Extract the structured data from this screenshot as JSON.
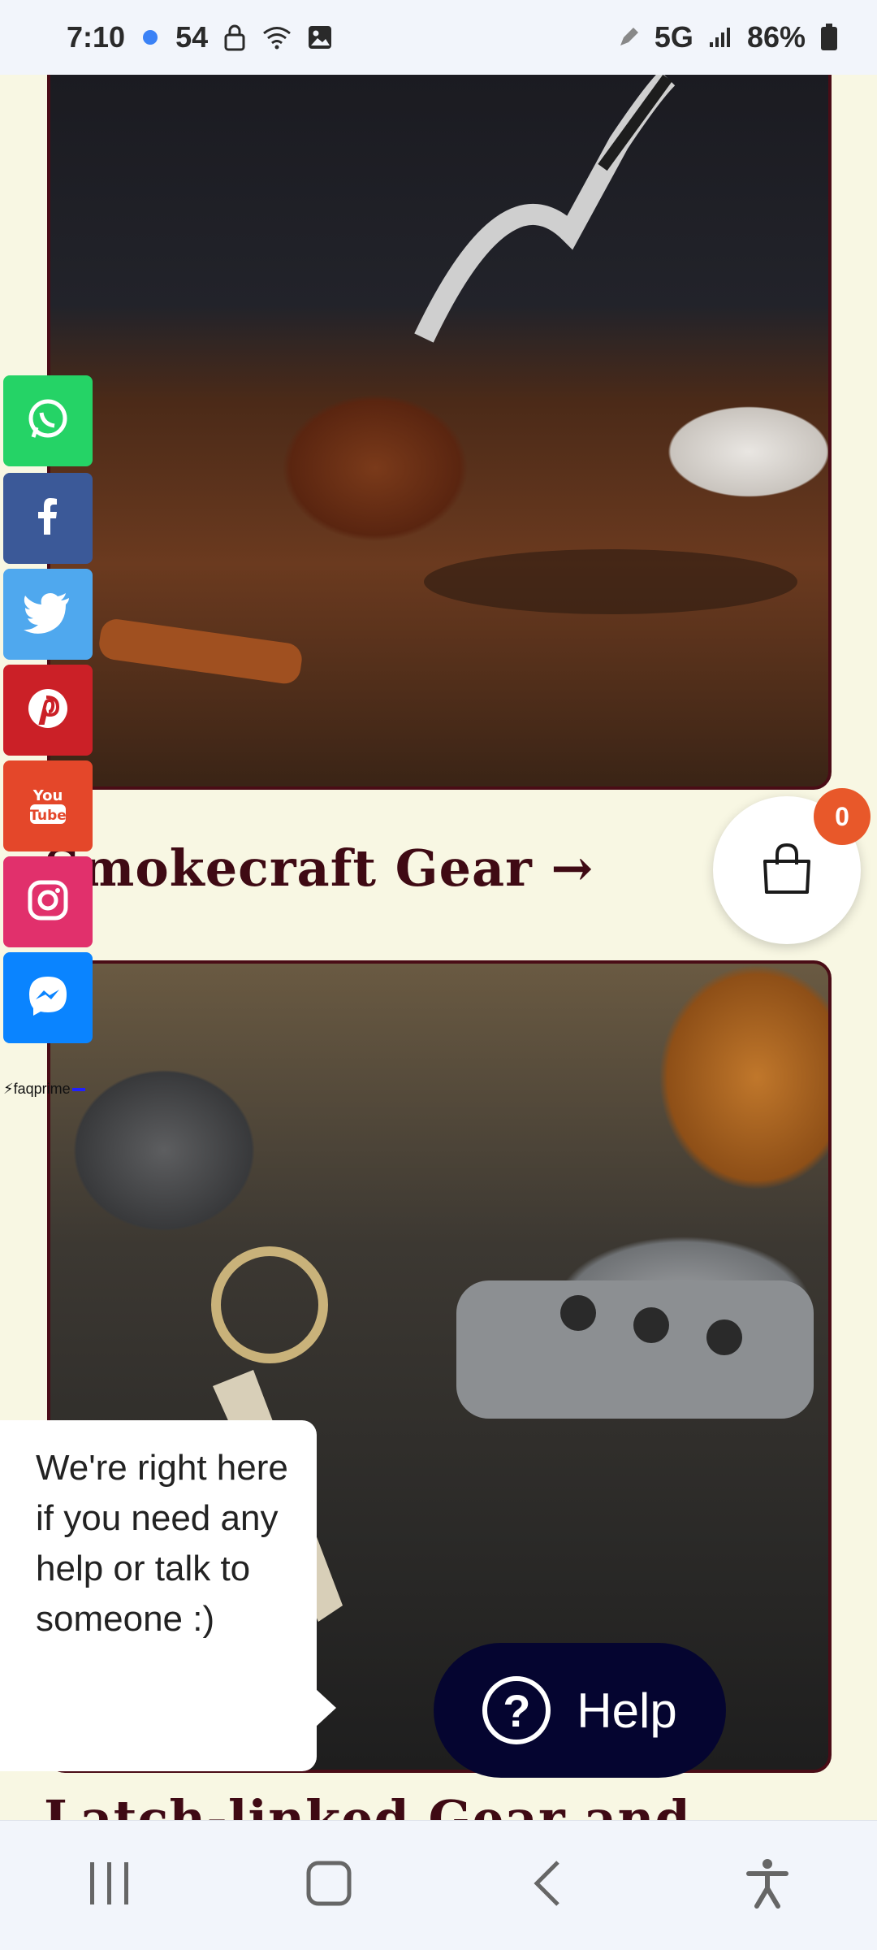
{
  "status_bar": {
    "time": "7:10",
    "temp": "54",
    "network": "5G",
    "battery": "86%"
  },
  "sections": [
    {
      "title": "Smokecraft Gear →",
      "image": "pipe-on-table-photo"
    },
    {
      "title": "Latch-linked Gear and",
      "image": "car-key-fob-photo"
    }
  ],
  "cart": {
    "count": "0"
  },
  "social": {
    "items": [
      "whatsapp",
      "facebook",
      "twitter",
      "pinterest",
      "youtube",
      "instagram",
      "messenger"
    ],
    "faq_label": "faqprime"
  },
  "help": {
    "bubble_text": "We're right here if you need any help or talk to someone :)",
    "button_label": "Help",
    "button_icon": "?"
  },
  "colors": {
    "page_bg": "#f8f7e3",
    "title": "#3f0a14",
    "badge": "#e8582a",
    "help_btn": "#050530"
  }
}
